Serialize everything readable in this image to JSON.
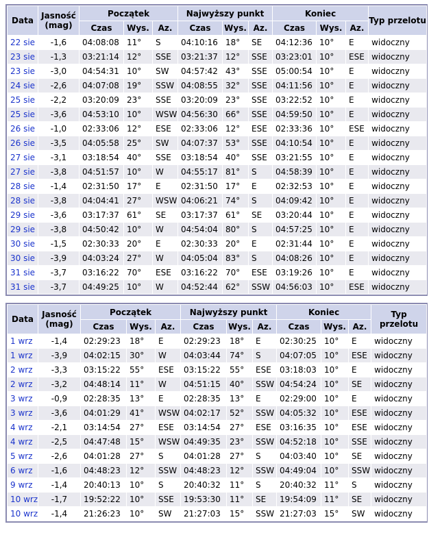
{
  "headers": {
    "data": "Data",
    "jasnosc": "Jasność",
    "mag": "(mag)",
    "poczatek": "Początek",
    "najwyzszy": "Najwyższy punkt",
    "koniec": "Koniec",
    "typ": "Typ przelotu",
    "czas": "Czas",
    "wys": "Wys.",
    "az": "Az."
  },
  "table1": [
    [
      "22 sie",
      "-1,6",
      "04:08:08",
      "11°",
      "S",
      "04:10:16",
      "18°",
      "SE",
      "04:12:36",
      "10°",
      "E",
      "widoczny"
    ],
    [
      "23 sie",
      "-1,3",
      "03:21:14",
      "12°",
      "SSE",
      "03:21:37",
      "12°",
      "SSE",
      "03:23:01",
      "10°",
      "ESE",
      "widoczny"
    ],
    [
      "23 sie",
      "-3,0",
      "04:54:31",
      "10°",
      "SW",
      "04:57:42",
      "43°",
      "SSE",
      "05:00:54",
      "10°",
      "E",
      "widoczny"
    ],
    [
      "24 sie",
      "-2,6",
      "04:07:08",
      "19°",
      "SSW",
      "04:08:55",
      "32°",
      "SSE",
      "04:11:56",
      "10°",
      "E",
      "widoczny"
    ],
    [
      "25 sie",
      "-2,2",
      "03:20:09",
      "23°",
      "SSE",
      "03:20:09",
      "23°",
      "SSE",
      "03:22:52",
      "10°",
      "E",
      "widoczny"
    ],
    [
      "25 sie",
      "-3,6",
      "04:53:10",
      "10°",
      "WSW",
      "04:56:30",
      "66°",
      "SSE",
      "04:59:50",
      "10°",
      "E",
      "widoczny"
    ],
    [
      "26 sie",
      "-1,0",
      "02:33:06",
      "12°",
      "ESE",
      "02:33:06",
      "12°",
      "ESE",
      "02:33:36",
      "10°",
      "ESE",
      "widoczny"
    ],
    [
      "26 sie",
      "-3,5",
      "04:05:58",
      "25°",
      "SW",
      "04:07:37",
      "53°",
      "SSE",
      "04:10:54",
      "10°",
      "E",
      "widoczny"
    ],
    [
      "27 sie",
      "-3,1",
      "03:18:54",
      "40°",
      "SSE",
      "03:18:54",
      "40°",
      "SSE",
      "03:21:55",
      "10°",
      "E",
      "widoczny"
    ],
    [
      "27 sie",
      "-3,8",
      "04:51:57",
      "10°",
      "W",
      "04:55:17",
      "81°",
      "S",
      "04:58:39",
      "10°",
      "E",
      "widoczny"
    ],
    [
      "28 sie",
      "-1,4",
      "02:31:50",
      "17°",
      "E",
      "02:31:50",
      "17°",
      "E",
      "02:32:53",
      "10°",
      "E",
      "widoczny"
    ],
    [
      "28 sie",
      "-3,8",
      "04:04:41",
      "27°",
      "WSW",
      "04:06:21",
      "74°",
      "S",
      "04:09:42",
      "10°",
      "E",
      "widoczny"
    ],
    [
      "29 sie",
      "-3,6",
      "03:17:37",
      "61°",
      "SE",
      "03:17:37",
      "61°",
      "SE",
      "03:20:44",
      "10°",
      "E",
      "widoczny"
    ],
    [
      "29 sie",
      "-3,8",
      "04:50:42",
      "10°",
      "W",
      "04:54:04",
      "80°",
      "S",
      "04:57:25",
      "10°",
      "E",
      "widoczny"
    ],
    [
      "30 sie",
      "-1,5",
      "02:30:33",
      "20°",
      "E",
      "02:30:33",
      "20°",
      "E",
      "02:31:44",
      "10°",
      "E",
      "widoczny"
    ],
    [
      "30 sie",
      "-3,9",
      "04:03:24",
      "27°",
      "W",
      "04:05:04",
      "83°",
      "S",
      "04:08:26",
      "10°",
      "E",
      "widoczny"
    ],
    [
      "31 sie",
      "-3,7",
      "03:16:22",
      "70°",
      "ESE",
      "03:16:22",
      "70°",
      "ESE",
      "03:19:26",
      "10°",
      "E",
      "widoczny"
    ],
    [
      "31 sie",
      "-3,7",
      "04:49:25",
      "10°",
      "W",
      "04:52:44",
      "62°",
      "SSW",
      "04:56:03",
      "10°",
      "ESE",
      "widoczny"
    ]
  ],
  "table2": [
    [
      "1 wrz",
      "-1,4",
      "02:29:23",
      "18°",
      "E",
      "02:29:23",
      "18°",
      "E",
      "02:30:25",
      "10°",
      "E",
      "widoczny"
    ],
    [
      "1 wrz",
      "-3,9",
      "04:02:15",
      "30°",
      "W",
      "04:03:44",
      "74°",
      "S",
      "04:07:05",
      "10°",
      "ESE",
      "widoczny"
    ],
    [
      "2 wrz",
      "-3,3",
      "03:15:22",
      "55°",
      "ESE",
      "03:15:22",
      "55°",
      "ESE",
      "03:18:03",
      "10°",
      "E",
      "widoczny"
    ],
    [
      "2 wrz",
      "-3,2",
      "04:48:14",
      "11°",
      "W",
      "04:51:15",
      "40°",
      "SSW",
      "04:54:24",
      "10°",
      "SE",
      "widoczny"
    ],
    [
      "3 wrz",
      "-0,9",
      "02:28:35",
      "13°",
      "E",
      "02:28:35",
      "13°",
      "E",
      "02:29:00",
      "10°",
      "E",
      "widoczny"
    ],
    [
      "3 wrz",
      "-3,6",
      "04:01:29",
      "41°",
      "WSW",
      "04:02:17",
      "52°",
      "SSW",
      "04:05:32",
      "10°",
      "ESE",
      "widoczny"
    ],
    [
      "4 wrz",
      "-2,1",
      "03:14:54",
      "27°",
      "ESE",
      "03:14:54",
      "27°",
      "ESE",
      "03:16:35",
      "10°",
      "ESE",
      "widoczny"
    ],
    [
      "4 wrz",
      "-2,5",
      "04:47:48",
      "15°",
      "WSW",
      "04:49:35",
      "23°",
      "SSW",
      "04:52:18",
      "10°",
      "SSE",
      "widoczny"
    ],
    [
      "5 wrz",
      "-2,6",
      "04:01:28",
      "27°",
      "S",
      "04:01:28",
      "27°",
      "S",
      "04:03:40",
      "10°",
      "SE",
      "widoczny"
    ],
    [
      "6 wrz",
      "-1,6",
      "04:48:23",
      "12°",
      "SSW",
      "04:48:23",
      "12°",
      "SSW",
      "04:49:04",
      "10°",
      "SSW",
      "widoczny"
    ],
    [
      "9 wrz",
      "-1,4",
      "20:40:13",
      "10°",
      "S",
      "20:40:32",
      "11°",
      "S",
      "20:40:32",
      "11°",
      "S",
      "widoczny"
    ],
    [
      "10 wrz",
      "-1,7",
      "19:52:22",
      "10°",
      "SSE",
      "19:53:30",
      "11°",
      "SE",
      "19:54:09",
      "11°",
      "SE",
      "widoczny"
    ],
    [
      "10 wrz",
      "-1,4",
      "21:26:23",
      "10°",
      "SW",
      "21:27:03",
      "15°",
      "SSW",
      "21:27:03",
      "15°",
      "SW",
      "widoczny"
    ]
  ]
}
